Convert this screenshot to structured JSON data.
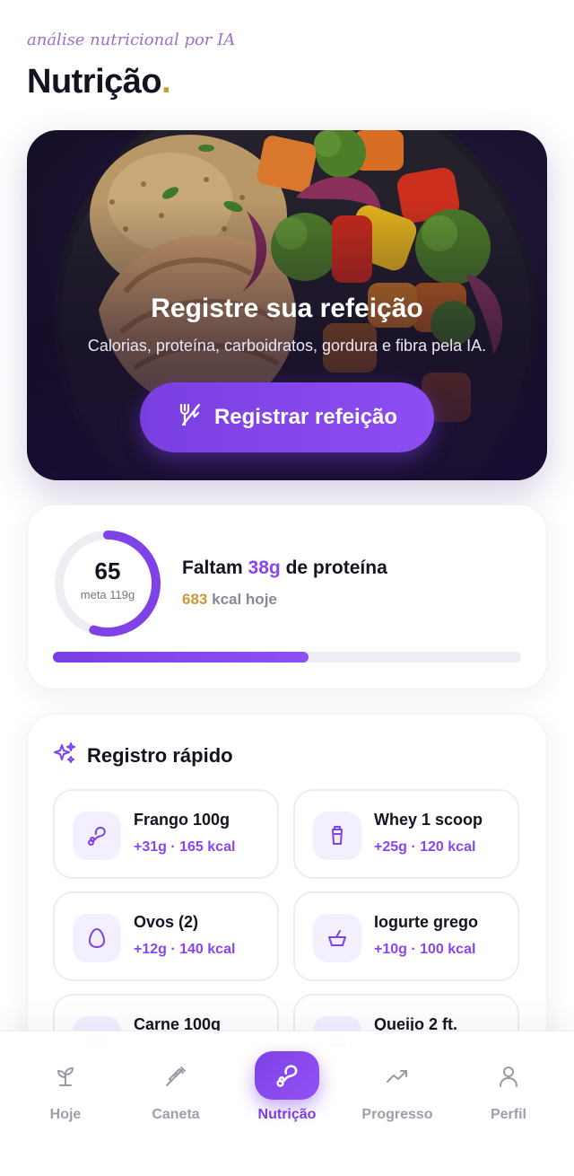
{
  "header": {
    "subtitle": "análise nutricional por IA",
    "title": "Nutrição",
    "title_dot": ".",
    "colors": {
      "accent_dot": "#c89b3c"
    }
  },
  "hero": {
    "title": "Registre sua refeição",
    "subtitle": "Calorias, proteína, carboidratos, gordura e fibra pela IA.",
    "button_label": "Registrar refeição",
    "button_icon": "fork-knife-icon"
  },
  "protein": {
    "current": "65",
    "goal_label": "meta 119g",
    "progress_fraction": 0.546,
    "line_prefix": "Faltam",
    "remaining": "38g",
    "line_suffix": "de proteína",
    "kcal_value": "683",
    "kcal_suffix": "kcal hoje"
  },
  "quick_log": {
    "title": "Registro rápido",
    "icon": "sparkles-icon",
    "items": [
      {
        "name": "Frango 100g",
        "meta": "+31g · 165 kcal",
        "icon": "drumstick-icon"
      },
      {
        "name": "Whey 1 scoop",
        "meta": "+25g · 120 kcal",
        "icon": "shaker-icon"
      },
      {
        "name": "Ovos (2)",
        "meta": "+12g · 140 kcal",
        "icon": "egg-icon"
      },
      {
        "name": "Iogurte grego",
        "meta": "+10g · 100 kcal",
        "icon": "bowl-icon"
      },
      {
        "name": "Carne 100g",
        "meta": "",
        "icon": "steak-icon"
      },
      {
        "name": "Queijo 2 ft.",
        "meta": "",
        "icon": "cheese-icon"
      }
    ]
  },
  "nav": {
    "items": [
      {
        "label": "Hoje",
        "icon": "sprout-icon"
      },
      {
        "label": "Caneta",
        "icon": "syringe-icon"
      },
      {
        "label": "Nutrição",
        "icon": "drumstick-icon",
        "active": true
      },
      {
        "label": "Progresso",
        "icon": "trend-up-icon"
      },
      {
        "label": "Perfil",
        "icon": "user-icon"
      }
    ]
  },
  "colors": {
    "primary": "#7a3fe0",
    "protein_highlight": "#8a45ee",
    "kcal_highlight": "#c9983a"
  }
}
